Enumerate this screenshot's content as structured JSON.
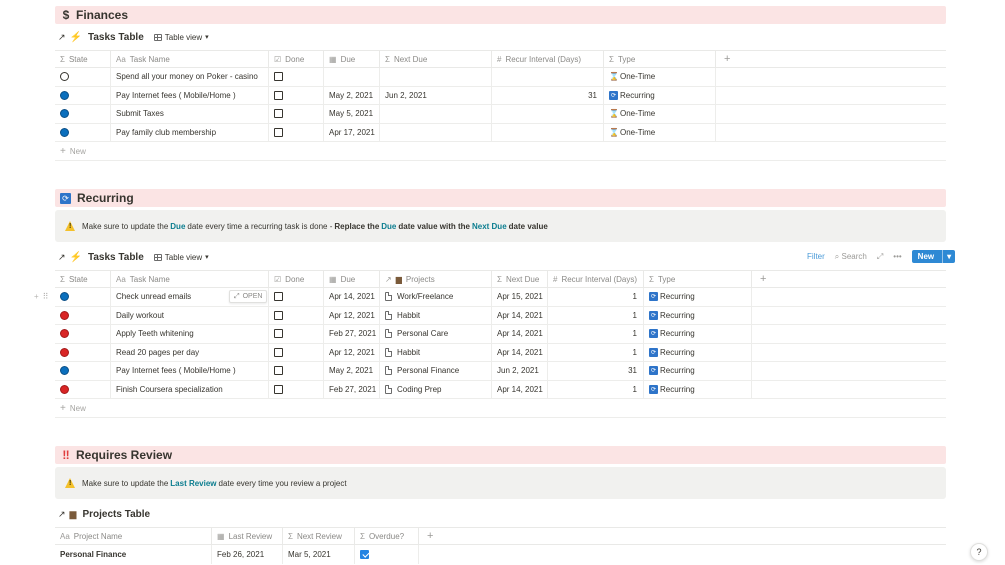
{
  "finances": {
    "icon": "$",
    "title": "Finances",
    "db_title": "Tasks Table",
    "view": "Table view",
    "columns": [
      "State",
      "Task Name",
      "Done",
      "Due",
      "Next Due",
      "Recur Interval (Days)",
      "Type"
    ],
    "rows": [
      {
        "state": "open",
        "name": "Spend all your money on Poker - casino",
        "done": false,
        "due": "",
        "next_due": "",
        "interval": "",
        "type": "One-Time"
      },
      {
        "state": "blue",
        "name": "Pay Internet fees ( Mobile/Home )",
        "done": false,
        "due": "May 2, 2021",
        "next_due": "Jun 2, 2021",
        "interval": "31",
        "type": "Recurring"
      },
      {
        "state": "blue",
        "name": "Submit Taxes",
        "done": false,
        "due": "May 5, 2021",
        "next_due": "",
        "interval": "",
        "type": "One-Time"
      },
      {
        "state": "blue",
        "name": "Pay family club membership",
        "done": false,
        "due": "Apr 17, 2021",
        "next_due": "",
        "interval": "",
        "type": "One-Time"
      }
    ],
    "new_label": "New"
  },
  "recurring": {
    "title": "Recurring",
    "callout": {
      "t1": "Make sure to update the ",
      "h1": "Due",
      "t2": " date every time a recurring task is done  - ",
      "b1": "Replace the ",
      "h2": "Due",
      "b2": " date value with the ",
      "h3": "Next Due",
      "b3": " date value"
    },
    "db_title": "Tasks Table",
    "view": "Table view",
    "toolbar": {
      "filter": "Filter",
      "search": "Search",
      "new": "New"
    },
    "columns": [
      "State",
      "Task Name",
      "Done",
      "Due",
      "Projects",
      "Next Due",
      "Recur Interval (Days)",
      "Type"
    ],
    "open_label": "OPEN",
    "rows": [
      {
        "state": "blue",
        "name": "Check unread emails",
        "done": false,
        "due": "Apr 14, 2021",
        "project": "Work/Freelance",
        "next_due": "Apr 15, 2021",
        "interval": "1",
        "type": "Recurring"
      },
      {
        "state": "red",
        "name": "Daily workout",
        "done": false,
        "due": "Apr 12, 2021",
        "project": "Habbit",
        "next_due": "Apr 14, 2021",
        "interval": "1",
        "type": "Recurring"
      },
      {
        "state": "red",
        "name": "Apply Teeth whitening",
        "done": false,
        "due": "Feb 27, 2021",
        "project": "Personal Care",
        "next_due": "Apr 14, 2021",
        "interval": "1",
        "type": "Recurring"
      },
      {
        "state": "red",
        "name": "Read 20 pages per day",
        "done": false,
        "due": "Apr 12, 2021",
        "project": "Habbit",
        "next_due": "Apr 14, 2021",
        "interval": "1",
        "type": "Recurring"
      },
      {
        "state": "blue",
        "name": "Pay Internet fees ( Mobile/Home )",
        "done": false,
        "due": "May 2, 2021",
        "project": "Personal Finance",
        "next_due": "Jun 2, 2021",
        "interval": "31",
        "type": "Recurring"
      },
      {
        "state": "red",
        "name": "Finish Coursera specialization",
        "done": false,
        "due": "Feb 27, 2021",
        "project": "Coding Prep",
        "next_due": "Apr 14, 2021",
        "interval": "1",
        "type": "Recurring"
      }
    ],
    "new_label": "New"
  },
  "review": {
    "icon": "‼",
    "title": "Requires Review",
    "callout": {
      "t1": "Make sure to update the ",
      "h1": "Last Review",
      "t2": " date every time you review a project"
    },
    "db_title": "Projects Table",
    "columns": [
      "Project Name",
      "Last Review",
      "Next Review",
      "Overdue?"
    ],
    "rows": [
      {
        "name": "Personal Finance",
        "last_review": "Feb 26, 2021",
        "next_review": "Mar 5, 2021",
        "overdue": true
      }
    ]
  },
  "help": "?",
  "colors": {
    "band": "#fbe4e4",
    "callout": "#f1f1ef",
    "accent": "#2e89d4",
    "blue_state": "#0b6fbd",
    "red_state": "#d92525",
    "highlight": "#0b7d8f"
  }
}
